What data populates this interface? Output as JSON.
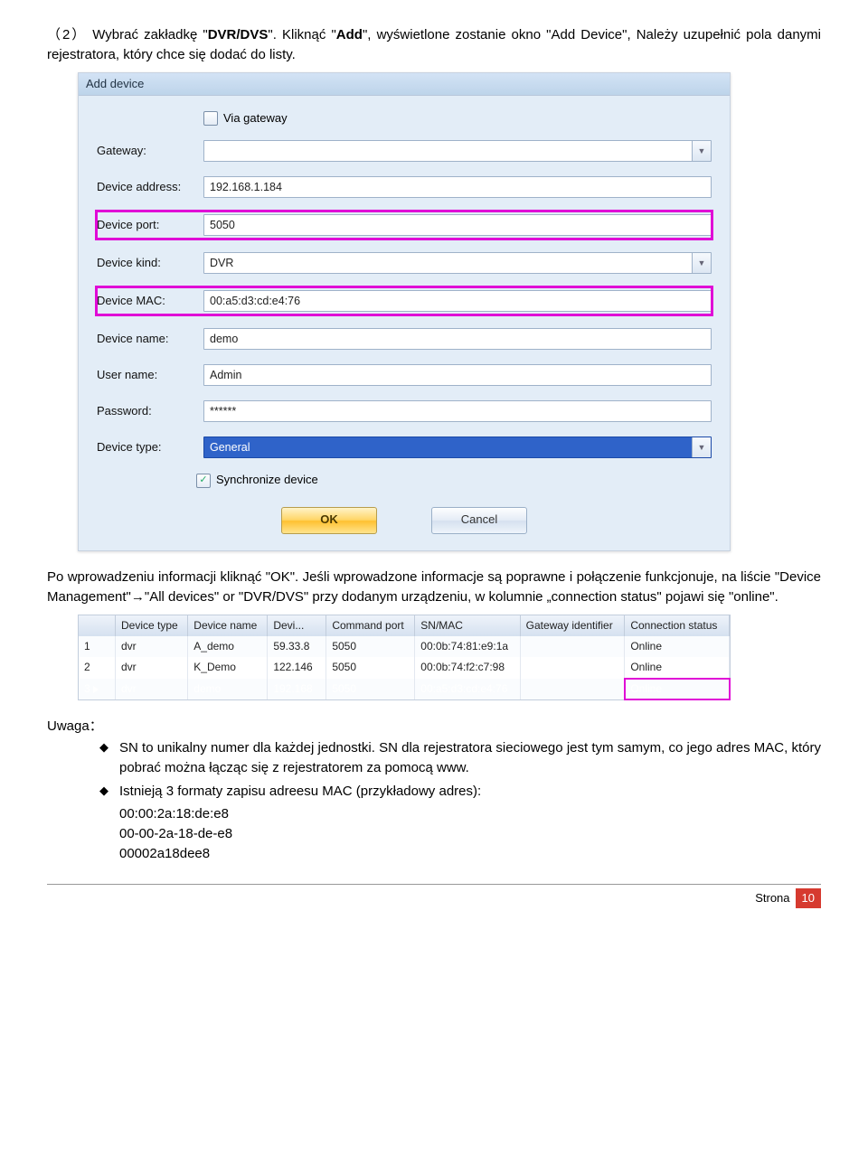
{
  "intro": {
    "prefix": "（2） Wybrać zakładkę \"",
    "bold1": "DVR/DVS",
    "mid": "\". Kliknąć \"",
    "bold2": "Add",
    "suffix": "\", wyświetlone zostanie okno \"Add Device\", Należy uzupełnić pola danymi rejestratora, który chce się dodać do listy."
  },
  "dialog": {
    "title": "Add device",
    "viaGateway": "Via gateway",
    "labels": {
      "gateway": "Gateway:",
      "address": "Device address:",
      "port": "Device port:",
      "kind": "Device kind:",
      "mac": "Device MAC:",
      "devname": "Device name:",
      "username": "User name:",
      "password": "Password:",
      "devtype": "Device type:"
    },
    "values": {
      "gateway": "",
      "address": "192.168.1.184",
      "port": "5050",
      "kind": "DVR",
      "mac": "00:a5:d3:cd:e4:76",
      "devname": "demo",
      "username": "Admin",
      "password": "******",
      "devtype": "General"
    },
    "sync": "Synchronize device",
    "ok": "OK",
    "cancel": "Cancel"
  },
  "para2": "Po wprowadzeniu informacji kliknąć \"OK\". Jeśli wprowadzone informacje są poprawne i połączenie funkcjonuje, na liście \"Device Management\"→\"All devices\" or \"DVR/DVS\" przy dodanym urządzeniu, w kolumnie „connection status\" pojawi się \"online\".",
  "table": {
    "headers": [
      "",
      "Device type",
      "Device name",
      "Devi...",
      "Command port",
      "SN/MAC",
      "Gateway identifier",
      "Connection status"
    ],
    "rows": [
      {
        "n": "1",
        "type": "dvr",
        "name": "A_demo",
        "addr": "59.33.8",
        "port": "5050",
        "mac": "00:0b:74:81:e9:1a",
        "gw": "",
        "status": "Online"
      },
      {
        "n": "2",
        "type": "dvr",
        "name": "K_Demo",
        "addr": "122.146",
        "port": "5050",
        "mac": "00:0b:74:f2:c7:98",
        "gw": "",
        "status": "Online"
      },
      {
        "n": "3",
        "type": "dvr",
        "name": "demo",
        "addr": "192.168",
        "port": "5050",
        "mac": "00:a5:d3:cd:e4:76",
        "gw": "",
        "status": "Online"
      }
    ]
  },
  "uwaga": "Uwaga：",
  "bullets": [
    "SN to unikalny numer dla każdej jednostki. SN dla rejestratora sieciowego jest tym samym, co jego adres MAC, który pobrać można łącząc się z rejestratorem za pomocą www.",
    "Istnieją 3 formaty zapisu adreesu MAC (przykładowy adres):"
  ],
  "macs": [
    "00:00:2a:18:de:e8",
    "00-00-2a-18-de-e8",
    "00002a18dee8"
  ],
  "footer": {
    "label": "Strona",
    "num": "10"
  }
}
